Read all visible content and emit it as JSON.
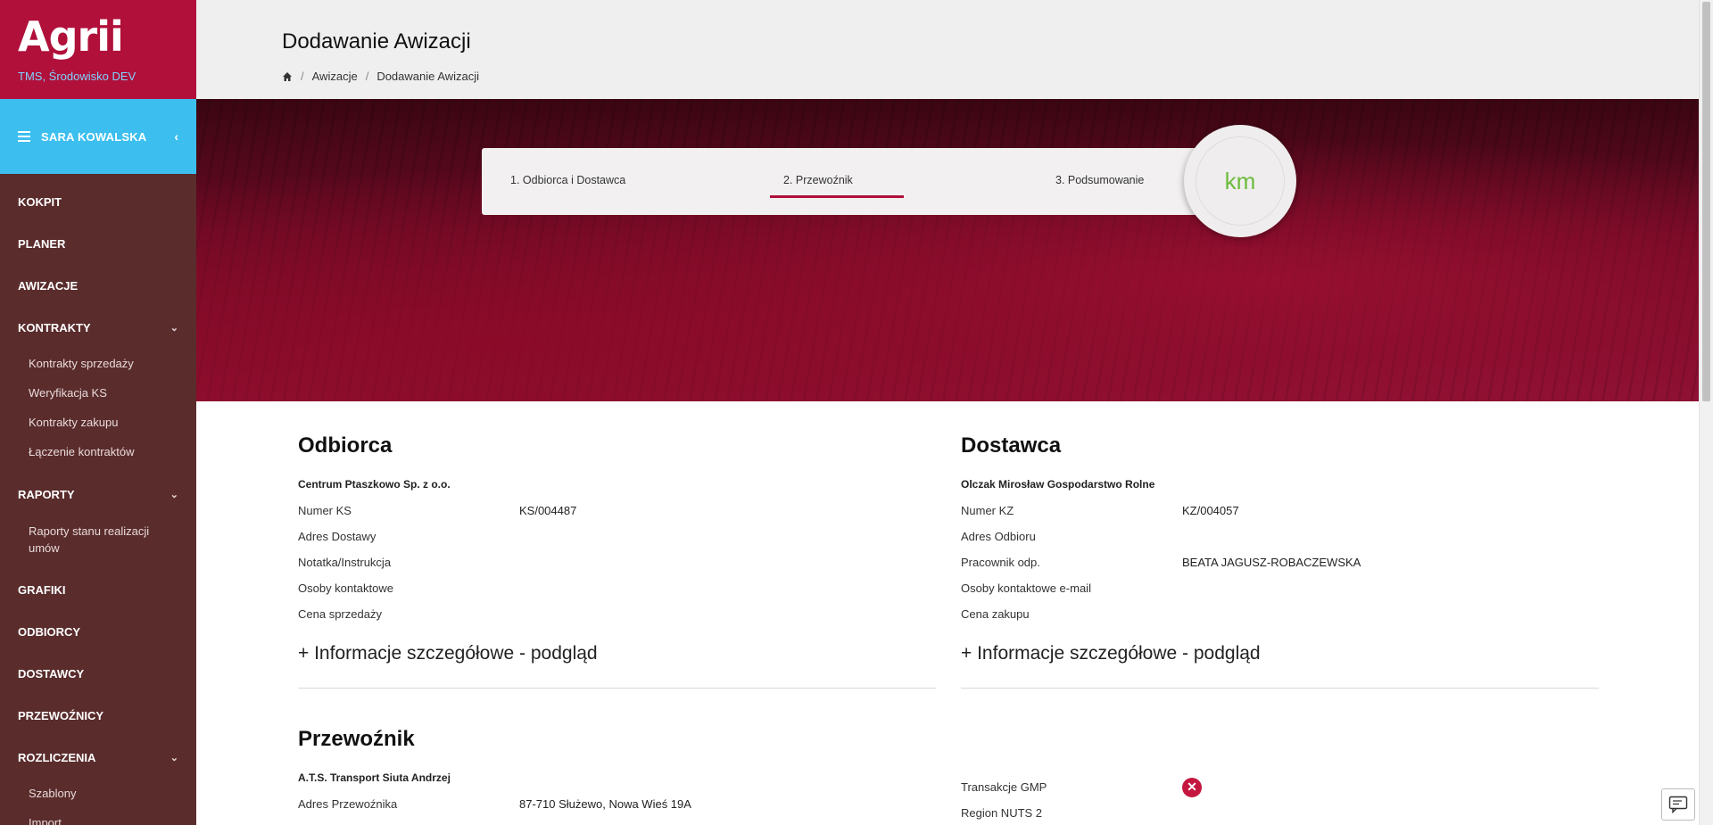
{
  "brand": {
    "logo": "Agrii",
    "environment": "TMS, Środowisko DEV"
  },
  "user": {
    "name": "SARA KOWALSKA"
  },
  "nav": {
    "kokpit": "KOKPIT",
    "planer": "PLANER",
    "awizacje": "AWIZACJE",
    "kontrakty": "KONTRAKTY",
    "kontrakty_sub": [
      "Kontrakty sprzedaży",
      "Weryfikacja KS",
      "Kontrakty zakupu",
      "Łączenie kontraktów"
    ],
    "raporty": "RAPORTY",
    "raporty_sub": [
      "Raporty stanu realizacji umów"
    ],
    "grafiki": "GRAFIKI",
    "odbiorcy": "ODBIORCY",
    "dostawcy": "DOSTAWCY",
    "przewoznicy": "PRZEWOŹNICY",
    "rozliczenia": "ROZLICZENIA",
    "rozliczenia_sub": [
      "Szablony",
      "Import"
    ]
  },
  "header": {
    "title": "Dodawanie Awizacji",
    "breadcrumb": [
      "Awizacje",
      "Dodawanie Awizacji"
    ]
  },
  "stepper": {
    "steps": [
      "1. Odbiorca i Dostawca",
      "2. Przewoźnik",
      "3. Podsumowanie"
    ],
    "active_step": 3,
    "badge": "km",
    "accent": "#b0103a",
    "badge_color": "#6cbb3c"
  },
  "odbiorca": {
    "title": "Odbiorca",
    "name": "Centrum Ptaszkowo Sp. z o.o.",
    "rows": [
      {
        "k": "Numer KS",
        "v": "KS/004487"
      },
      {
        "k": "Adres Dostawy",
        "v": ""
      },
      {
        "k": "Notatka/Instrukcja",
        "v": ""
      },
      {
        "k": "Osoby kontaktowe",
        "v": ""
      },
      {
        "k": "Cena sprzedaży",
        "v": ""
      }
    ],
    "more": "+ Informacje szczegółowe - podgląd"
  },
  "dostawca": {
    "title": "Dostawca",
    "name": "Olczak Mirosław Gospodarstwo Rolne",
    "rows": [
      {
        "k": "Numer KZ",
        "v": "KZ/004057"
      },
      {
        "k": "Adres Odbioru",
        "v": ""
      },
      {
        "k": "Pracownik odp.",
        "v": "BEATA JAGUSZ-ROBACZEWSKA"
      },
      {
        "k": "Osoby kontaktowe e-mail",
        "v": ""
      },
      {
        "k": "Cena zakupu",
        "v": ""
      }
    ],
    "more": "+ Informacje szczegółowe - podgląd"
  },
  "przewoznik": {
    "title": "Przewoźnik",
    "name": "A.T.S. Transport Siuta Andrzej",
    "rows": [
      {
        "k": "Adres Przewoźnika",
        "v": "87-710 Służewo, Nowa Wieś 19A"
      }
    ],
    "right_rows": [
      {
        "k": "Transakcje GMP",
        "v": ""
      },
      {
        "k": "Region NUTS 2",
        "v": ""
      }
    ]
  }
}
